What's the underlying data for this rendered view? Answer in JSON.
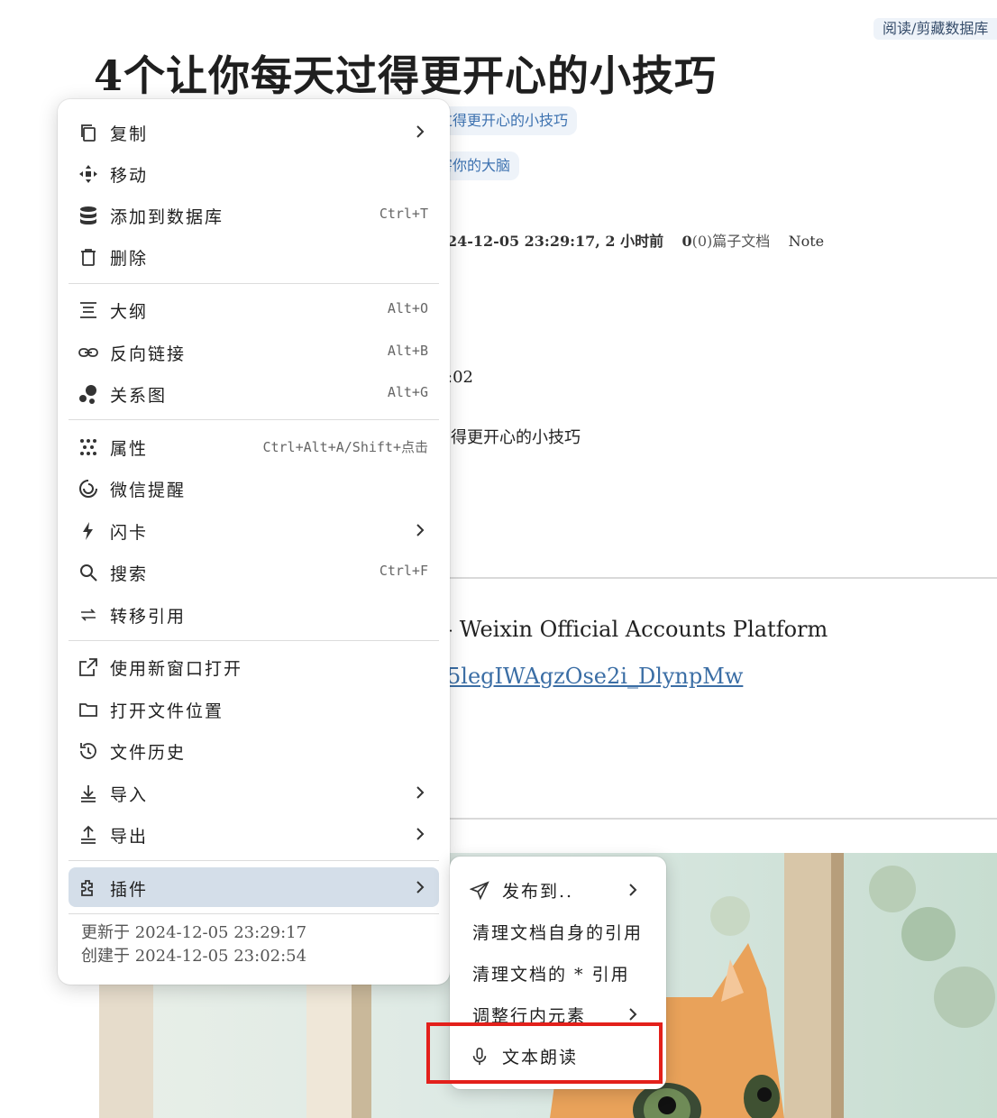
{
  "top_tag": "阅读/剪藏数据库",
  "document": {
    "title": "4个让你每天过得更开心的小技巧",
    "chip_1": "过得更开心的小技巧",
    "chip_2": "害你的大脑",
    "meta": {
      "updated": "24-12-05 23:29:17, 2 小时前",
      "count": "0",
      "count_suffix": "(0)篇子文档",
      "type": "Note"
    },
    "line_time": ":02",
    "line_title": "得更开心的小技巧",
    "source_text": "- Weixin Official Accounts Platform",
    "link_text": "5legIWAgzOse2i_DlynpMw"
  },
  "context_menu": {
    "items": [
      {
        "label": "复制",
        "shortcut": "",
        "submenu": true,
        "icon": "copy-icon"
      },
      {
        "label": "移动",
        "shortcut": "",
        "submenu": false,
        "icon": "move-icon"
      },
      {
        "label": "添加到数据库",
        "shortcut": "Ctrl+T",
        "submenu": false,
        "icon": "database-icon"
      },
      {
        "label": "删除",
        "shortcut": "",
        "submenu": false,
        "icon": "trash-icon"
      },
      {
        "label": "大纲",
        "shortcut": "Alt+O",
        "submenu": false,
        "icon": "outline-icon"
      },
      {
        "label": "反向链接",
        "shortcut": "Alt+B",
        "submenu": false,
        "icon": "link-icon"
      },
      {
        "label": "关系图",
        "shortcut": "Alt+G",
        "submenu": false,
        "icon": "graph-icon"
      },
      {
        "label": "属性",
        "shortcut": "Ctrl+Alt+A/Shift+点击",
        "submenu": false,
        "icon": "attributes-icon"
      },
      {
        "label": "微信提醒",
        "shortcut": "",
        "submenu": false,
        "icon": "wechat-reminder-icon"
      },
      {
        "label": "闪卡",
        "shortcut": "",
        "submenu": true,
        "icon": "flashcard-icon"
      },
      {
        "label": "搜索",
        "shortcut": "Ctrl+F",
        "submenu": false,
        "icon": "search-icon"
      },
      {
        "label": "转移引用",
        "shortcut": "",
        "submenu": false,
        "icon": "transfer-icon"
      },
      {
        "label": "使用新窗口打开",
        "shortcut": "",
        "submenu": false,
        "icon": "open-new-window-icon"
      },
      {
        "label": "打开文件位置",
        "shortcut": "",
        "submenu": false,
        "icon": "folder-icon"
      },
      {
        "label": "文件历史",
        "shortcut": "",
        "submenu": false,
        "icon": "history-icon"
      },
      {
        "label": "导入",
        "shortcut": "",
        "submenu": true,
        "icon": "import-icon"
      },
      {
        "label": "导出",
        "shortcut": "",
        "submenu": true,
        "icon": "export-icon"
      },
      {
        "label": "插件",
        "shortcut": "",
        "submenu": true,
        "icon": "plugin-icon"
      }
    ],
    "footer": {
      "updated": "更新于 2024-12-05 23:29:17",
      "created": "创建于 2024-12-05 23:02:54"
    }
  },
  "plugin_submenu": {
    "items": [
      {
        "label": "发布到..",
        "submenu": true,
        "icon": "send-icon"
      },
      {
        "label": "清理文档自身的引用",
        "submenu": false
      },
      {
        "label": "清理文档的 * 引用",
        "submenu": false
      },
      {
        "label": "调整行内元素",
        "submenu": true
      },
      {
        "label": "文本朗读",
        "submenu": false,
        "icon": "microphone-icon"
      }
    ]
  },
  "colors": {
    "menu_active_bg": "#d4dee9",
    "link": "#3b6ea5",
    "highlight_border": "#e3201b",
    "chip_bg": "#eef3f9"
  }
}
